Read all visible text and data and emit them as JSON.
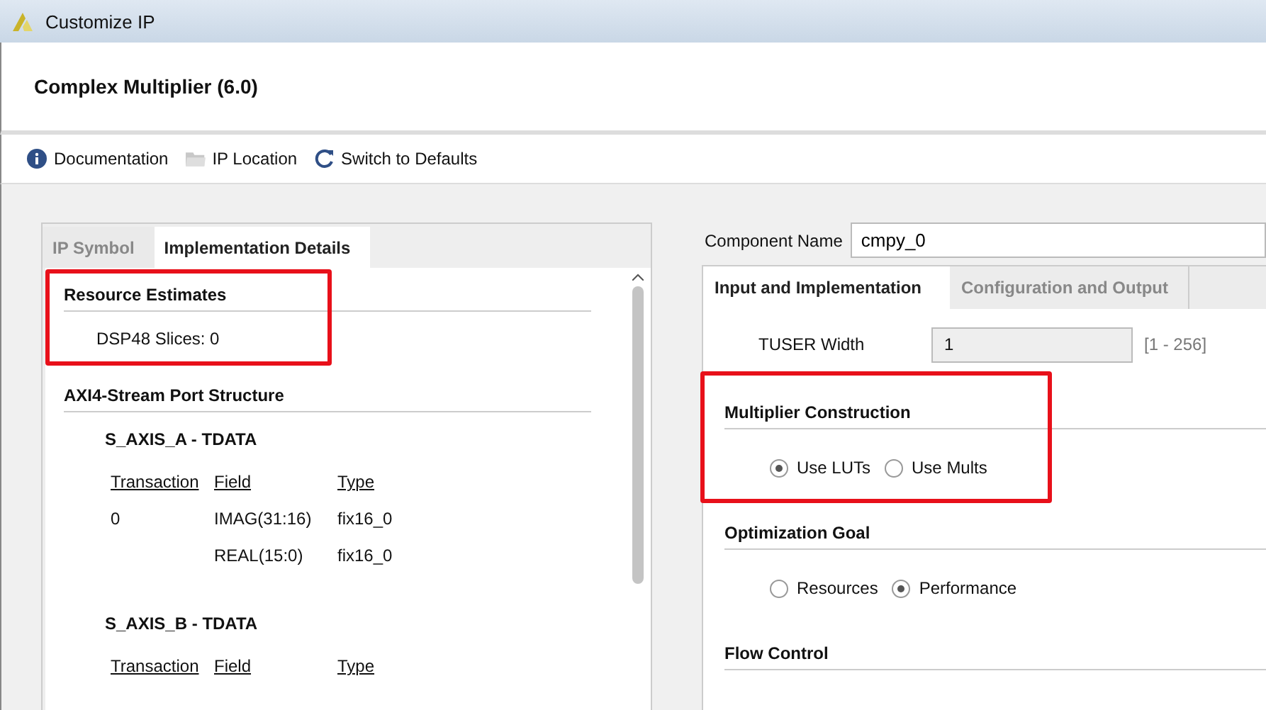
{
  "window": {
    "title": "Customize IP"
  },
  "header": {
    "title": "Complex Multiplier (6.0)"
  },
  "toolbar": [
    {
      "kind": "info",
      "label": "Documentation"
    },
    {
      "kind": "folder",
      "label": "IP Location"
    },
    {
      "kind": "refresh",
      "label": "Switch to Defaults"
    }
  ],
  "left_panel": {
    "tabs": [
      {
        "label": "IP Symbol",
        "selected": false
      },
      {
        "label": "Implementation Details",
        "selected": true
      }
    ],
    "resource_estimates": {
      "title": "Resource Estimates",
      "highlighted": true,
      "items": [
        "DSP48 Slices: 0"
      ]
    },
    "port_structure": {
      "title": "AXI4-Stream Port Structure",
      "ports": [
        {
          "name": "S_AXIS_A - TDATA",
          "columns": [
            "Transaction",
            "Field",
            "Type"
          ],
          "rows": [
            [
              "0",
              "IMAG(31:16)",
              "fix16_0"
            ],
            [
              "",
              "REAL(15:0)",
              "fix16_0"
            ]
          ]
        },
        {
          "name": "S_AXIS_B - TDATA",
          "columns": [
            "Transaction",
            "Field",
            "Type"
          ]
        }
      ]
    }
  },
  "right_panel": {
    "component_name": {
      "label": "Component Name",
      "value": "cmpy_0"
    },
    "tabs": [
      {
        "label": "Input and Implementation",
        "selected": true
      },
      {
        "label": "Configuration and Output",
        "selected": false
      }
    ],
    "tuser_width": {
      "label": "TUSER Width",
      "value": "1",
      "range": "[1 - 256]",
      "disabled": true
    },
    "sections": [
      {
        "title": "Multiplier Construction",
        "highlighted": true,
        "options": [
          {
            "label": "Use LUTs",
            "selected": true
          },
          {
            "label": "Use Mults",
            "selected": false
          }
        ]
      },
      {
        "title": "Optimization Goal",
        "highlighted": false,
        "options": [
          {
            "label": "Resources",
            "selected": false
          },
          {
            "label": "Performance",
            "selected": true
          }
        ]
      },
      {
        "title": "Flow Control",
        "highlighted": false
      }
    ]
  }
}
